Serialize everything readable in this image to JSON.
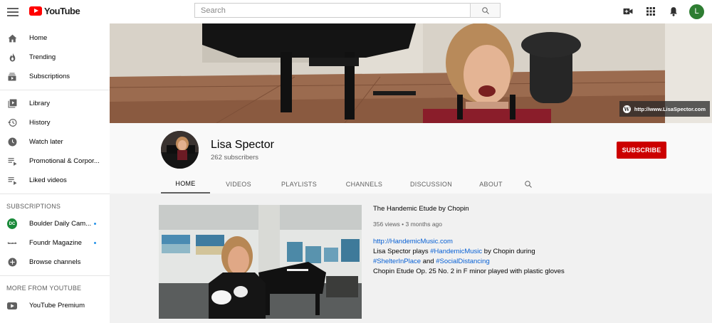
{
  "topbar": {
    "logo_text": "YouTube",
    "search_placeholder": "Search",
    "avatar_letter": "L",
    "icons": [
      "menu-icon",
      "search-icon",
      "video-camera-icon",
      "apps-grid-icon",
      "bell-icon"
    ]
  },
  "sidebar": {
    "main_items": [
      {
        "label": "Home",
        "icon": "home-icon"
      },
      {
        "label": "Trending",
        "icon": "flame-icon"
      },
      {
        "label": "Subscriptions",
        "icon": "subscriptions-icon"
      }
    ],
    "library_items": [
      {
        "label": "Library",
        "icon": "library-icon"
      },
      {
        "label": "History",
        "icon": "history-icon"
      },
      {
        "label": "Watch later",
        "icon": "clock-icon"
      },
      {
        "label": "Promotional & Corpor...",
        "icon": "playlist-icon"
      },
      {
        "label": "Liked videos",
        "icon": "playlist-icon"
      }
    ],
    "subscriptions_heading": "SUBSCRIPTIONS",
    "subscriptions": [
      {
        "label": "Boulder Daily Cam...",
        "avatar_text": "DC",
        "avatar_color": "#1a8a3a"
      },
      {
        "label": "Foundr Magazine",
        "avatar_text": "foundr",
        "avatar_color": "#ffffff"
      },
      {
        "label": "Browse channels",
        "icon": "plus-circle-icon"
      }
    ],
    "more_heading": "MORE FROM YOUTUBE",
    "more_items": [
      {
        "label": "YouTube Premium",
        "icon": "youtube-premium-icon"
      }
    ]
  },
  "banner": {
    "link_text": "http://www.LisaSpector.com"
  },
  "channel": {
    "name": "Lisa Spector",
    "subscribers": "262 subscribers",
    "subscribe_label": "SUBSCRIBE",
    "tabs": [
      "HOME",
      "VIDEOS",
      "PLAYLISTS",
      "CHANNELS",
      "DISCUSSION",
      "ABOUT"
    ],
    "active_tab": "HOME"
  },
  "featured_video": {
    "title": "The Handemic Etude by Chopin",
    "meta": "356 views • 3 months ago",
    "link": "http://HandemicMusic.com",
    "desc_line2_prefix": "Lisa Spector plays ",
    "desc_line2_hashtag": "#HandemicMusic",
    "desc_line2_suffix": " by Chopin during",
    "desc_line3_hashtag1": "#ShelterInPlace",
    "desc_line3_and": " and ",
    "desc_line3_hashtag2": "#SocialDistancing",
    "desc_line4": "Chopin Etude Op. 25 No. 2 in F minor played with plastic gloves"
  },
  "colors": {
    "brand_red": "#ff0000",
    "subscribe_red": "#cc0000",
    "link_blue": "#065fd4",
    "avatar_green": "#2e7d32"
  }
}
